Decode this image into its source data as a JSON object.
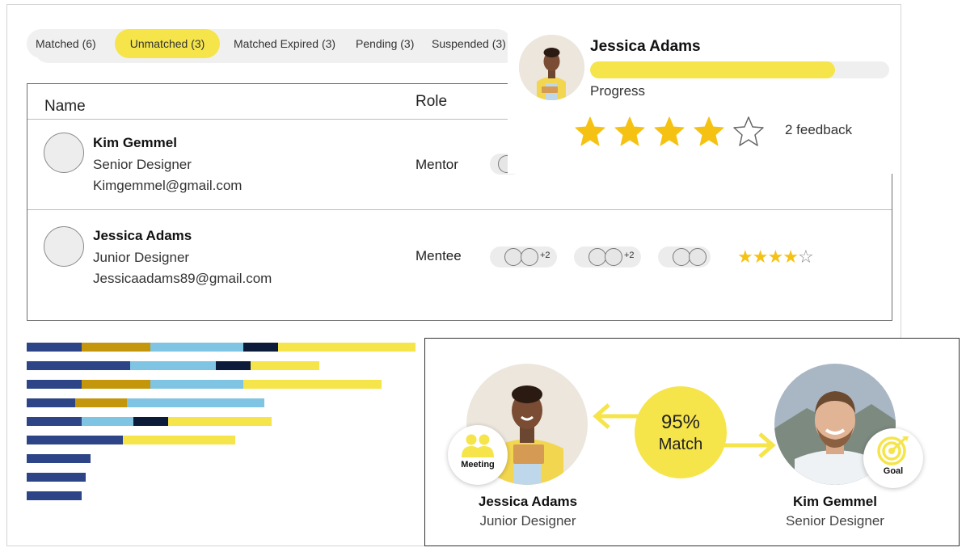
{
  "tabs": [
    {
      "label": "Matched (6)",
      "active": false
    },
    {
      "label": "Unmatched (3)",
      "active": true
    },
    {
      "label": "Matched Expired (3)",
      "active": false
    },
    {
      "label": "Pending (3)",
      "active": false
    },
    {
      "label": "Suspended (3)",
      "active": false
    }
  ],
  "table": {
    "headers": {
      "name": "Name",
      "role": "Role"
    },
    "rows": [
      {
        "name": "Kim Gemmel",
        "title": "Senior Designer",
        "email": "Kimgemmel@gmail.com",
        "role": "Mentor"
      },
      {
        "name": "Jessica Adams",
        "title": "Junior Designer",
        "email": "Jessicaadams89@gmail.com",
        "role": "Mentee",
        "group1_more": "+2",
        "group2_more": "+2",
        "rating": 4,
        "rating_max": 5
      }
    ]
  },
  "profile_popup": {
    "name": "Jessica Adams",
    "progress": 0.82,
    "progress_label": "Progress",
    "rating": 4,
    "rating_max": 5,
    "feedback": "2 feedback"
  },
  "bar_colors": {
    "navy": "#2d4486",
    "gold": "#c4960c",
    "sky": "#7fc4e2",
    "dark": "#0d1b3a",
    "yellow": "#f5e44a"
  },
  "bar_chart": [
    [
      {
        "c": "navy",
        "v": 68
      },
      {
        "c": "gold",
        "v": 85
      },
      {
        "c": "sky",
        "v": 115
      },
      {
        "c": "dark",
        "v": 43
      },
      {
        "c": "yellow",
        "v": 170
      }
    ],
    [
      {
        "c": "navy",
        "v": 128
      },
      {
        "c": "sky",
        "v": 106
      },
      {
        "c": "dark",
        "v": 43
      },
      {
        "c": "yellow",
        "v": 85
      }
    ],
    [
      {
        "c": "navy",
        "v": 68
      },
      {
        "c": "gold",
        "v": 85
      },
      {
        "c": "sky",
        "v": 115
      },
      {
        "c": "yellow",
        "v": 171
      }
    ],
    [
      {
        "c": "navy",
        "v": 60
      },
      {
        "c": "gold",
        "v": 64
      },
      {
        "c": "sky",
        "v": 170
      }
    ],
    [
      {
        "c": "navy",
        "v": 68
      },
      {
        "c": "sky",
        "v": 64
      },
      {
        "c": "dark",
        "v": 43
      },
      {
        "c": "yellow",
        "v": 128
      }
    ],
    [
      {
        "c": "navy",
        "v": 119
      },
      {
        "c": "yellow",
        "v": 139
      }
    ],
    [
      {
        "c": "navy",
        "v": 79
      }
    ],
    [
      {
        "c": "navy",
        "v": 73
      }
    ],
    [
      {
        "c": "navy",
        "v": 68
      }
    ]
  ],
  "match_card": {
    "mentee": {
      "name": "Jessica Adams",
      "role": "Junior Designer",
      "badge": "Meeting",
      "badge_icon": "people-icon"
    },
    "mentor": {
      "name": "Kim Gemmel",
      "role": "Senior Designer",
      "badge": "Goal",
      "badge_icon": "target-icon"
    },
    "match_percent": "95%",
    "match_word": "Match"
  }
}
